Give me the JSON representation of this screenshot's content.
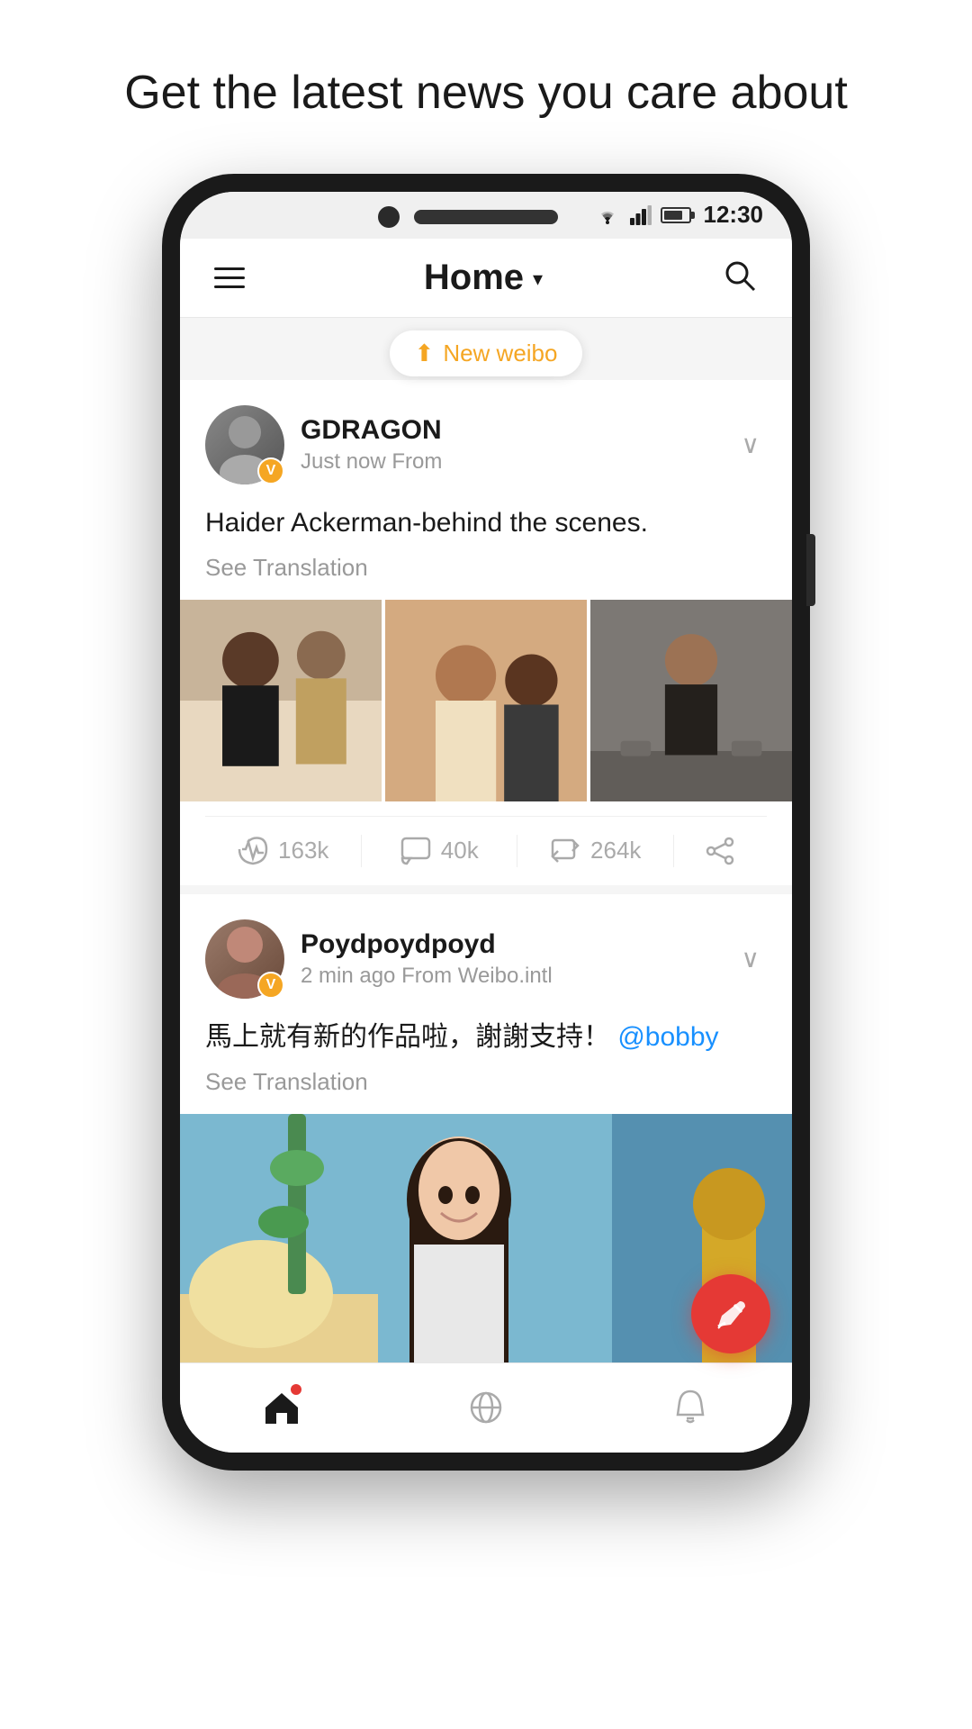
{
  "headline": "Get the latest news you care about",
  "status_bar": {
    "time": "12:30"
  },
  "top_nav": {
    "title": "Home",
    "hamburger_label": "menu",
    "search_label": "search"
  },
  "new_weibo": {
    "label": "New weibo"
  },
  "posts": [
    {
      "id": "post1",
      "username": "GDRAGON",
      "time": "Just now",
      "from": "From",
      "text": "Haider Ackerman-behind the scenes.",
      "see_translation": "See Translation",
      "likes": "163k",
      "comments": "40k",
      "reposts": "264k",
      "image_count": 3
    },
    {
      "id": "post2",
      "username": "Poydpoydpoyd",
      "time": "2 min ago",
      "from": "From Weibo.intl",
      "text": "馬上就有新的作品啦，謝謝支持！",
      "mention": "@bobby",
      "see_translation": "See Translation",
      "image_count": 1
    }
  ],
  "bottom_nav": {
    "home": "home",
    "explore": "explore",
    "notifications": "notifications"
  },
  "fab": {
    "label": "compose"
  }
}
